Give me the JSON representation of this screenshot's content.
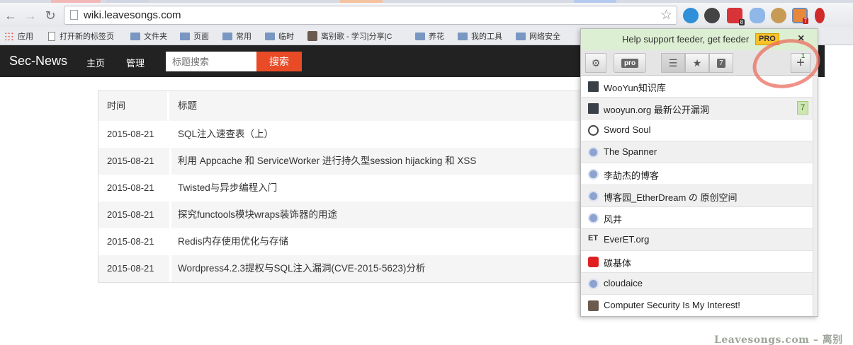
{
  "browser": {
    "url": "wiki.leavesongs.com",
    "bookmarks": [
      "应用",
      "打开新的标签页",
      "文件夹",
      "页面",
      "常用",
      "临时",
      "离别歌 - 学习|分享|C",
      "养花",
      "我的工具",
      "网络安全"
    ],
    "extension_badges": {
      "red_ext": "8",
      "feeder_ext": "7"
    }
  },
  "site": {
    "brand": "Sec-News",
    "nav": [
      "主页",
      "管理"
    ],
    "search_placeholder": "标题搜索",
    "search_button": "搜索"
  },
  "table": {
    "headers": [
      "时间",
      "标题"
    ],
    "rows": [
      {
        "time": "2015-08-21",
        "title": "SQL注入速查表（上）"
      },
      {
        "time": "2015-08-21",
        "title": "利用 Appcache 和 ServiceWorker 进行持久型session hijacking 和 XSS"
      },
      {
        "time": "2015-08-21",
        "title": "Twisted与异步编程入门"
      },
      {
        "time": "2015-08-21",
        "title": "探究functools模块wraps装饰器的用途"
      },
      {
        "time": "2015-08-21",
        "title": "Redis内存使用优化与存储"
      },
      {
        "time": "2015-08-21",
        "title": "Wordpress4.2.3提权与SQL注入漏洞(CVE-2015-5623)分析"
      }
    ]
  },
  "feeder": {
    "banner_text": "Help support feeder, get feeder",
    "pro_badge": "PRO",
    "close": "×",
    "toolbar": {
      "pro": "pro",
      "count": "7",
      "add_count": "1"
    },
    "feeds": [
      {
        "name": "WooYun知识库",
        "icon": "dark",
        "unread": ""
      },
      {
        "name": "wooyun.org 最新公开漏洞",
        "icon": "dark",
        "unread": "7"
      },
      {
        "name": "Sword Soul",
        "icon": "ring",
        "unread": ""
      },
      {
        "name": "The Spanner",
        "icon": "globe",
        "unread": ""
      },
      {
        "name": "李劼杰的博客",
        "icon": "globe",
        "unread": ""
      },
      {
        "name": "博客园_EtherDream の 原创空间",
        "icon": "globe",
        "unread": ""
      },
      {
        "name": "风井",
        "icon": "globe",
        "unread": ""
      },
      {
        "name": "EverET.org",
        "icon": "et",
        "unread": ""
      },
      {
        "name": "碳基体",
        "icon": "red",
        "unread": ""
      },
      {
        "name": "cloudaice",
        "icon": "globe",
        "unread": ""
      },
      {
        "name": "Computer Security Is My Interest!",
        "icon": "person",
        "unread": ""
      }
    ]
  },
  "watermark": "Leavesongs.com – 离别歌"
}
